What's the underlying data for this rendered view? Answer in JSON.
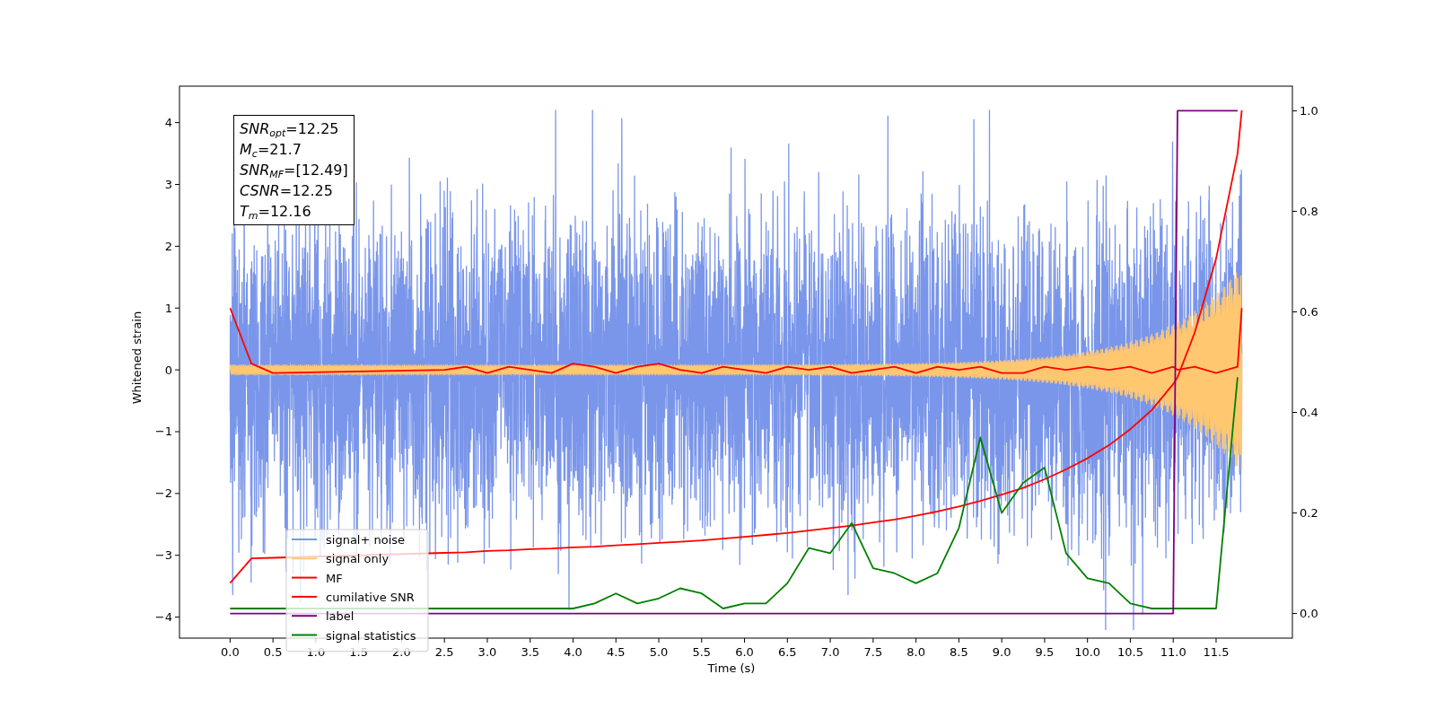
{
  "chart_data": {
    "type": "line",
    "xlabel": "Time (s)",
    "ylabel": "Whitened strain",
    "xlim": [
      -0.59,
      12.39
    ],
    "ylim": [
      -4.34,
      4.59
    ],
    "y2lim": [
      -0.049,
      1.049
    ],
    "xticks": [
      {
        "value": 0,
        "label": "0.0"
      },
      {
        "value": 0.5,
        "label": "0.5"
      },
      {
        "value": 1,
        "label": "1.0"
      },
      {
        "value": 1.5,
        "label": "1.5"
      },
      {
        "value": 2,
        "label": "2.0"
      },
      {
        "value": 2.5,
        "label": "2.5"
      },
      {
        "value": 3,
        "label": "3.0"
      },
      {
        "value": 3.5,
        "label": "3.5"
      },
      {
        "value": 4,
        "label": "4.0"
      },
      {
        "value": 4.5,
        "label": "4.5"
      },
      {
        "value": 5,
        "label": "5.0"
      },
      {
        "value": 5.5,
        "label": "5.5"
      },
      {
        "value": 6,
        "label": "6.0"
      },
      {
        "value": 6.5,
        "label": "6.5"
      },
      {
        "value": 7,
        "label": "7.0"
      },
      {
        "value": 7.5,
        "label": "7.5"
      },
      {
        "value": 8,
        "label": "8.0"
      },
      {
        "value": 8.5,
        "label": "8.5"
      },
      {
        "value": 9,
        "label": "9.0"
      },
      {
        "value": 9.5,
        "label": "9.5"
      },
      {
        "value": 10,
        "label": "10.0"
      },
      {
        "value": 10.5,
        "label": "10.5"
      },
      {
        "value": 11,
        "label": "11.0"
      },
      {
        "value": 11.5,
        "label": "11.5"
      }
    ],
    "yticks": [
      {
        "value": -4,
        "label": "−4"
      },
      {
        "value": -3,
        "label": "−3"
      },
      {
        "value": -2,
        "label": "−2"
      },
      {
        "value": -1,
        "label": "−1"
      },
      {
        "value": 0,
        "label": "0"
      },
      {
        "value": 1,
        "label": "1"
      },
      {
        "value": 2,
        "label": "2"
      },
      {
        "value": 3,
        "label": "3"
      },
      {
        "value": 4,
        "label": "4"
      }
    ],
    "y2ticks": [
      {
        "value": 0,
        "label": "0.0"
      },
      {
        "value": 0.2,
        "label": "0.2"
      },
      {
        "value": 0.4,
        "label": "0.4"
      },
      {
        "value": 0.6,
        "label": "0.6"
      },
      {
        "value": 0.8,
        "label": "0.8"
      },
      {
        "value": 1,
        "label": "1.0"
      }
    ],
    "x": [
      0,
      0.25,
      0.5,
      2.5,
      2.75,
      3,
      3.25,
      3.5,
      3.75,
      4,
      4.25,
      4.5,
      4.75,
      5,
      5.25,
      5.5,
      5.75,
      6,
      6.25,
      6.5,
      6.75,
      7,
      7.25,
      7.5,
      7.75,
      8,
      8.25,
      8.5,
      8.75,
      9,
      9.25,
      9.5,
      9.75,
      10,
      10.25,
      10.5,
      10.75,
      11,
      11.05,
      11.25,
      11.5,
      11.75,
      11.8
    ],
    "series": [
      {
        "name": "MF",
        "color": "#ff0000",
        "values": [
          1,
          0.1,
          -0.05,
          0,
          0.05,
          -0.05,
          0.05,
          0,
          -0.05,
          0.1,
          0.05,
          -0.05,
          0.05,
          0.1,
          0,
          -0.05,
          0.05,
          0,
          -0.05,
          0.05,
          0,
          0.05,
          -0.05,
          0,
          0.05,
          -0.05,
          0.05,
          0,
          0.05,
          -0.05,
          -0.05,
          0.05,
          0,
          0.05,
          0,
          0.05,
          -0.05,
          0.05,
          0,
          0.05,
          -0.05,
          0.05,
          1
        ]
      },
      {
        "name": "cumilative SNR",
        "color": "#ff0000",
        "values": [
          -3.45,
          -3.05,
          -3.04,
          -2.96,
          -2.95,
          -2.93,
          -2.92,
          -2.9,
          -2.89,
          -2.87,
          -2.86,
          -2.84,
          -2.82,
          -2.8,
          -2.78,
          -2.76,
          -2.73,
          -2.7,
          -2.67,
          -2.64,
          -2.6,
          -2.56,
          -2.52,
          -2.47,
          -2.42,
          -2.36,
          -2.29,
          -2.21,
          -2.12,
          -2.02,
          -1.91,
          -1.77,
          -1.61,
          -1.43,
          -1.22,
          -0.96,
          -0.65,
          -0.23,
          -0.12,
          0.6,
          1.8,
          3.5,
          4.2
        ]
      },
      {
        "name": "label",
        "color": "#800080",
        "axis": "y2",
        "values": [
          0,
          0,
          0,
          0,
          0,
          0,
          0,
          0,
          0,
          0,
          0,
          0,
          0,
          0,
          0,
          0,
          0,
          0,
          0,
          0,
          0,
          0,
          0,
          0,
          0,
          0,
          0,
          0,
          0,
          0,
          0,
          0,
          0,
          0,
          0,
          0,
          0,
          0,
          1,
          1,
          1,
          1,
          null
        ]
      },
      {
        "name": "signal statistics",
        "color": "#008000",
        "axis": "y2",
        "values": [
          0.01,
          0.01,
          0.01,
          0.01,
          0.01,
          0.01,
          0.01,
          0.01,
          0.01,
          0.01,
          0.02,
          0.04,
          0.02,
          0.03,
          0.05,
          0.04,
          0.01,
          0.02,
          0.02,
          0.06,
          0.13,
          0.12,
          0.18,
          0.09,
          0.08,
          0.06,
          0.08,
          0.17,
          0.35,
          0.2,
          0.26,
          0.29,
          0.12,
          0.07,
          0.06,
          0.02,
          0.01,
          0.01,
          0.01,
          0.01,
          0.01,
          0.47,
          null
        ]
      }
    ],
    "legend": true
  },
  "traces": [
    {
      "name": "signal+ noise",
      "color": "#7a96ea",
      "kind": "noise"
    },
    {
      "name": "signal only",
      "color": "#ffc870",
      "kind": "chirp"
    }
  ],
  "annotation": [
    "*SNR*$_{opt}$=12.25",
    "*M*$_{c}$=21.7",
    "*SNR*$_{MF}$=[12.49]",
    "*CSNR*=12.25",
    "*T*$_{m}$=12.16"
  ]
}
